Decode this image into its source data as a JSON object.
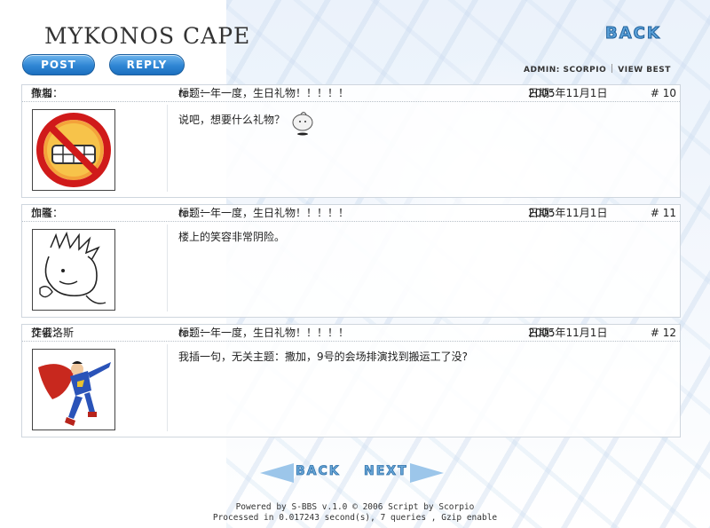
{
  "header": {
    "site_title": "MYKONOS CAPE",
    "back_label": "BACK",
    "post_label": "POST",
    "reply_label": "REPLY",
    "admin_text": "ADMIN: SCORPIO",
    "view_best_label": "VIEW BEST"
  },
  "posts": [
    {
      "author_label": "作者：",
      "author": "撒加",
      "subject_label": "标题：",
      "subject": "re：一年一度，生日礼物！！！！！",
      "date_label": "日期：",
      "date": "2005年11月1日",
      "floor": "# 10",
      "body": "说吧，想要什么礼物？",
      "avatar_icon": "no-smiling-icon"
    },
    {
      "author_label": "作者：",
      "author": "加隆",
      "subject_label": "标题：",
      "subject": "re：一年一度，生日礼物！！！！！",
      "date_label": "日期：",
      "date": "2005年11月1日",
      "floor": "# 11",
      "body": "楼上的笑容非常阴险。",
      "avatar_icon": "sketch-character-icon"
    },
    {
      "author_label": "作者：",
      "author": "艾俄洛斯",
      "subject_label": "标题：",
      "subject": "re：一年一度，生日礼物！！！！！",
      "date_label": "日期：",
      "date": "2005年11月1日",
      "floor": "# 12",
      "body": "我插一句，无关主题：撒加，9号的会场排演找到搬运工了没?",
      "avatar_icon": "superhero-icon"
    }
  ],
  "pager": {
    "back_label": "BACK",
    "next_label": "NEXT"
  },
  "footer": {
    "line1": "Powered by S-BBS v.1.0 © 2006 Script by Scorpio",
    "line2": "Processed in 0.017243 second(s), 7 queries , Gzip enable"
  },
  "colors": {
    "accent": "#2f86d4",
    "text": "#222222"
  }
}
